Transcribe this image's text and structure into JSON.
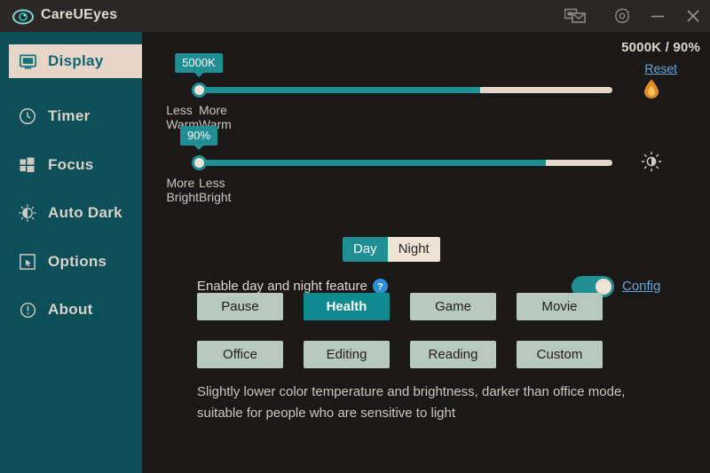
{
  "window": {
    "title": "CareUEyes",
    "logo_icon": "eye-icon",
    "controls": [
      {
        "name": "screenshot-mail-icon",
        "label": ""
      },
      {
        "name": "gear-icon",
        "label": ""
      },
      {
        "name": "minimize-icon",
        "label": ""
      },
      {
        "name": "close-icon",
        "label": ""
      }
    ]
  },
  "sidebar": {
    "items": [
      {
        "label": "Display",
        "icon": "monitor-icon",
        "active": true
      },
      {
        "label": "Timer",
        "icon": "clock-icon",
        "active": false
      },
      {
        "label": "Focus",
        "icon": "windows-icon",
        "active": false
      },
      {
        "label": "Auto Dark",
        "icon": "half-sun-icon",
        "active": false
      },
      {
        "label": "Options",
        "icon": "cursor-box-icon",
        "active": false
      },
      {
        "label": "About",
        "icon": "info-icon",
        "active": false
      }
    ]
  },
  "main": {
    "readout": "5000K / 90%",
    "reset_label": "Reset",
    "warm_icon": "flame-drop-icon",
    "bright_icon": "brightness-icon",
    "temperature_slider": {
      "badge": "5000K",
      "left_caption": "More Warm",
      "right_caption": "Less Warm",
      "percent": 68,
      "value_k": 5000
    },
    "brightness_slider": {
      "badge": "90%",
      "left_caption": "Less Bright",
      "right_caption": "More Bright",
      "percent": 84,
      "value_pct": 90
    },
    "day_night": {
      "options": [
        {
          "label": "Day",
          "active": true
        },
        {
          "label": "Night",
          "active": false
        }
      ]
    },
    "enable_row": {
      "label": "Enable day and night feature",
      "help_icon": "question-mark-icon",
      "toggle_on": true,
      "config_label": "Config"
    },
    "presets": [
      {
        "label": "Pause",
        "active": false
      },
      {
        "label": "Health",
        "active": true
      },
      {
        "label": "Game",
        "active": false
      },
      {
        "label": "Movie",
        "active": false
      },
      {
        "label": "Office",
        "active": false
      },
      {
        "label": "Editing",
        "active": false
      },
      {
        "label": "Reading",
        "active": false
      },
      {
        "label": "Custom",
        "active": false
      }
    ],
    "description": "Slightly lower color temperature and brightness, darker than office mode, suitable for people who are sensitive to light"
  },
  "colors": {
    "accent_teal": "#1f8f93",
    "sidebar_teal": "#0d4f58",
    "background": "#1b1917",
    "titlebar": "#2b2724",
    "highlight_beige": "#e7d6c8",
    "link_blue": "#6aa6d8",
    "preset_bg": "#b7c8c0",
    "warm_orange": "#e08a28"
  }
}
